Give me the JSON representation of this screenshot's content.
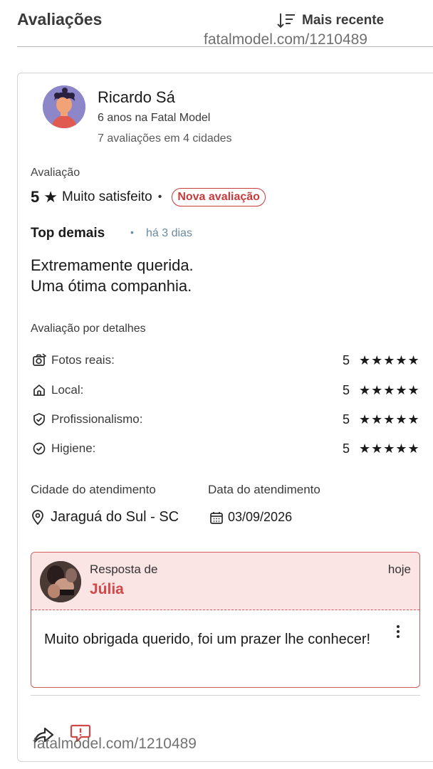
{
  "header": {
    "title": "Avaliações",
    "sort_label": "Mais recente",
    "watermark": "fatalmodel.com/1210489"
  },
  "review": {
    "user": {
      "name": "Ricardo Sá",
      "tenure": "6 anos na Fatal Model",
      "reviews_count": "7 avaliações em 4 cidades"
    },
    "rating": {
      "label": "Avaliação",
      "score": "5",
      "star": "★",
      "text": "Muito satisfeito",
      "dot": "•",
      "badge": "Nova avaliação"
    },
    "title": "Top demais",
    "dot": "•",
    "time": "há 3 dias",
    "body_line1": "Extremamente querida.",
    "body_line2": "Uma ótima companhia.",
    "details_title": "Avaliação por detalhes",
    "details": [
      {
        "icon": "camera-icon",
        "label": "Fotos reais:",
        "score": "5",
        "stars": "★★★★★"
      },
      {
        "icon": "home-icon",
        "label": "Local:",
        "score": "5",
        "stars": "★★★★★"
      },
      {
        "icon": "shield-check-icon",
        "label": "Profissionalismo:",
        "score": "5",
        "stars": "★★★★★"
      },
      {
        "icon": "check-circle-icon",
        "label": "Higiene:",
        "score": "5",
        "stars": "★★★★★"
      }
    ],
    "city_label": "Cidade do atendimento",
    "city_value": "Jaraguá do Sul - SC",
    "date_label": "Data do atendimento",
    "date_value": "03/09/2026",
    "reply": {
      "from_label": "Resposta de",
      "name": "Júlia",
      "when": "hoje",
      "text": "Muito obrigada querido, foi um prazer lhe conhecer!"
    }
  },
  "footer": {
    "watermark": "fatalmodel.com/1210489"
  },
  "colors": {
    "accent_red": "#d24848",
    "reply_bg": "#fbe4e4",
    "avatar_bg": "#8d86c8",
    "muted_blue": "#6a8aa0"
  }
}
